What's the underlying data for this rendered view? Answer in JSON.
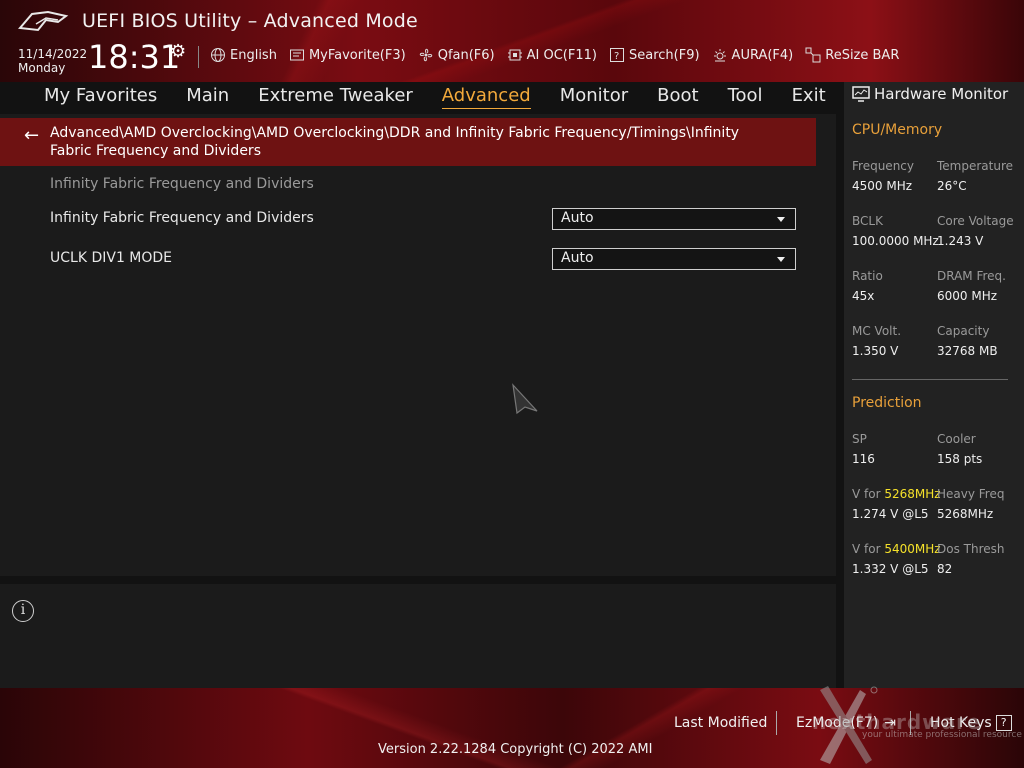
{
  "app": {
    "title": "UEFI BIOS Utility – Advanced Mode",
    "date": "11/14/2022",
    "day": "Monday",
    "time": "18:31"
  },
  "toolbar": [
    {
      "label": "English",
      "icon": "globe-icon"
    },
    {
      "label": "MyFavorite(F3)",
      "icon": "favorite-icon"
    },
    {
      "label": "Qfan(F6)",
      "icon": "fan-icon"
    },
    {
      "label": "AI OC(F11)",
      "icon": "ai-oc-icon"
    },
    {
      "label": "Search(F9)",
      "icon": "search-icon"
    },
    {
      "label": "AURA(F4)",
      "icon": "aura-icon"
    },
    {
      "label": "ReSize BAR",
      "icon": "resize-bar-icon"
    }
  ],
  "nav": {
    "tabs": [
      "My Favorites",
      "Main",
      "Extreme Tweaker",
      "Advanced",
      "Monitor",
      "Boot",
      "Tool",
      "Exit"
    ],
    "active": "Advanced"
  },
  "breadcrumb": "Advanced\\AMD Overclocking\\AMD Overclocking\\DDR and Infinity Fabric Frequency/Timings\\Infinity Fabric Frequency and Dividers",
  "section_label": "Infinity Fabric Frequency and Dividers",
  "settings": [
    {
      "label": "Infinity Fabric Frequency and Dividers",
      "value": "Auto"
    },
    {
      "label": "UCLK DIV1 MODE",
      "value": "Auto"
    }
  ],
  "hw_monitor": {
    "title": "Hardware Monitor",
    "cpu_memory": {
      "heading": "CPU/Memory",
      "frequency_label": "Frequency",
      "frequency_value": "4500 MHz",
      "temperature_label": "Temperature",
      "temperature_value": "26°C",
      "bclk_label": "BCLK",
      "bclk_value": "100.0000 MHz",
      "core_voltage_label": "Core Voltage",
      "core_voltage_value": "1.243 V",
      "ratio_label": "Ratio",
      "ratio_value": "45x",
      "dram_freq_label": "DRAM Freq.",
      "dram_freq_value": "6000 MHz",
      "mc_volt_label": "MC Volt.",
      "mc_volt_value": "1.350 V",
      "capacity_label": "Capacity",
      "capacity_value": "32768 MB"
    },
    "prediction": {
      "heading": "Prediction",
      "sp_label": "SP",
      "sp_value": "116",
      "cooler_label": "Cooler",
      "cooler_value": "158 pts",
      "v1_prefix": "V for ",
      "v1_freq": "5268MHz",
      "v1_value": "1.274 V @L5",
      "heavy_freq_label": "Heavy Freq",
      "heavy_freq_value": "5268MHz",
      "v2_prefix": "V for ",
      "v2_freq": "5400MHz",
      "v2_value": "1.332 V @L5",
      "dos_thresh_label": "Dos Thresh",
      "dos_thresh_value": "82"
    }
  },
  "footer": {
    "last_modified": "Last Modified",
    "ezmode": "EzMode(F7)",
    "hot_keys": "Hot Keys",
    "hot_keys_key": "?",
    "version": "Version 2.22.1284 Copyright (C) 2022 AMI"
  },
  "watermark": {
    "brand": "nexthardware",
    "tagline": "your ultimate professional resource"
  },
  "colors": {
    "accent": "#f2a93b",
    "breadcrumb_bg": "#6e1212",
    "highlight": "#f5e12a"
  }
}
